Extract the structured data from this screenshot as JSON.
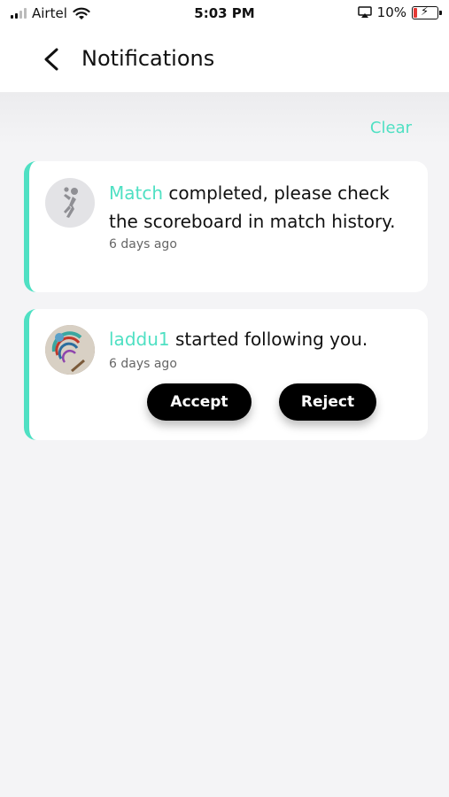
{
  "status_bar": {
    "carrier": "Airtel",
    "time": "5:03 PM",
    "battery": "10%"
  },
  "header": {
    "title": "Notifications"
  },
  "actions": {
    "clear_label": "Clear"
  },
  "notifications": [
    {
      "highlight": "Match",
      "text": " completed, please check the scoreboard in match history.",
      "time": "6 days ago"
    },
    {
      "highlight": "laddu1",
      "text": " started following you.",
      "time": "6 days ago",
      "accept_label": "Accept",
      "reject_label": "Reject"
    }
  ],
  "colors": {
    "accent": "#4fe0c3",
    "button": "#000000",
    "background": "#f4f4f6"
  },
  "icons": {
    "back": "chevron-left-icon",
    "match_avatar": "volleyball-player-icon",
    "wifi": "wifi-icon",
    "airplay": "airplay-icon"
  }
}
